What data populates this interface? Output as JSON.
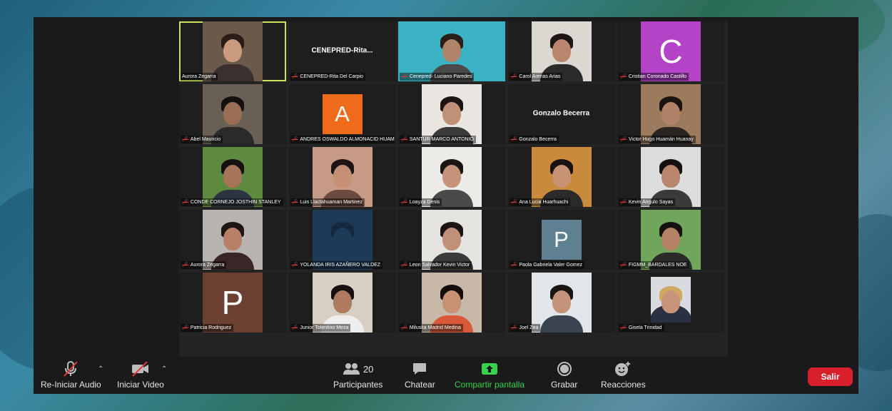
{
  "participants": [
    {
      "name": "Aurora Zegarra",
      "type": "video",
      "active": true,
      "bg": "#6b5a4a",
      "skin": "#c99a7e",
      "hair": "#2a1d17",
      "shirt": "#3a3030"
    },
    {
      "name": "CENEPRED-Rita Del Carpio",
      "type": "name",
      "display": "CENEPRED-Rita..."
    },
    {
      "name": "Cenepred- Luciano Paredes",
      "type": "video",
      "wide": true,
      "bg": "#3bb3c4",
      "skin": "#b08468",
      "hair": "#2a1f18",
      "shirt": "#4a4a4a"
    },
    {
      "name": "Carol Arenas Arias",
      "type": "video",
      "bg": "#ddd7d2",
      "skin": "#b8866c",
      "hair": "#1e1614",
      "shirt": "#2b2b2b"
    },
    {
      "name": "Cristian Coronado Castillo",
      "type": "letter",
      "letter": "C",
      "color": "#b443c8"
    },
    {
      "name": "Abel Mauricio",
      "type": "video",
      "bg": "#6a5f55",
      "skin": "#9a6e55",
      "hair": "#141010",
      "shirt": "#2a2a2a"
    },
    {
      "name": "ANDRES OSWALDO ALMONACID HUAMAN",
      "type": "letter",
      "letter": "A",
      "color": "#ef6a1a"
    },
    {
      "name": "SANTUR MARCO ANTONIO",
      "type": "video",
      "bg": "#e9e6e2",
      "skin": "#c09078",
      "hair": "#1b1412",
      "shirt": "#3a3a3a"
    },
    {
      "name": "Gonzalo Becerra",
      "type": "name",
      "display": "Gonzalo Becerra"
    },
    {
      "name": "Victor Hugo Huamán Huanay",
      "type": "video",
      "bg": "#9c7a5c",
      "skin": "#b28268",
      "hair": "#1a1311",
      "shirt": "#2a2520"
    },
    {
      "name": "CONDE CORNEJO JOSTHIN STANLEY",
      "type": "video",
      "bg": "#5d8a3f",
      "skin": "#a57459",
      "hair": "#161010",
      "shirt": "#2c3440"
    },
    {
      "name": "Luis Llactahuaman Martinez",
      "type": "video",
      "bg": "#c79a85",
      "skin": "#c58f73",
      "hair": "#1d1513",
      "shirt": "#6b4a40"
    },
    {
      "name": "Loayza Denis",
      "type": "video",
      "bg": "#ecebe7",
      "skin": "#c4937a",
      "hair": "#1a1412",
      "shirt": "#4a4a4a"
    },
    {
      "name": "Ana Lucia Huarhuachi",
      "type": "video",
      "bg": "#c98a3c",
      "skin": "#c89274",
      "hair": "#1a1210",
      "shirt": "#2a2a2a"
    },
    {
      "name": "Kevin Angulo Sayas",
      "type": "video",
      "bg": "#dcdcdc",
      "skin": "#b8866d",
      "hair": "#161010",
      "shirt": "#3a3a3a"
    },
    {
      "name": "Aurora Zegarra",
      "type": "video",
      "bg": "#b8b4b0",
      "skin": "#b88066",
      "hair": "#1e1412",
      "shirt": "#3a2626"
    },
    {
      "name": "YOLANDA IRIS AZAÑERO VALDEZ",
      "type": "video",
      "bg": "#1d3a56",
      "skin": "#1d3a56",
      "hair": "#14293e",
      "shirt": "#1d3a56"
    },
    {
      "name": "Leon Salvador Kevin Victor",
      "type": "video",
      "bg": "#e6e4e0",
      "skin": "#c09078",
      "hair": "#1a1412",
      "shirt": "#3a3a3a"
    },
    {
      "name": "Paola Gabriela Valer Gomez",
      "type": "letter",
      "letter": "P",
      "color": "#5f8090"
    },
    {
      "name": "FIGMM_BARDALES NOE",
      "type": "video",
      "bg": "#6fa65c",
      "skin": "#b78367",
      "hair": "#161010",
      "shirt": "#2a2a2a"
    },
    {
      "name": "Patricia Rodriguez",
      "type": "letter",
      "letter": "P",
      "color": "#6b4030"
    },
    {
      "name": "Junior Tolentino Meza",
      "type": "video",
      "bg": "#d8cfc4",
      "skin": "#b07a60",
      "hair": "#161010",
      "shirt": "#eeeeee"
    },
    {
      "name": "Miluska Madrid Medina",
      "type": "video",
      "bg": "#c8b8a8",
      "skin": "#c79174",
      "hair": "#120c0b",
      "shirt": "#d85a3a"
    },
    {
      "name": "Joel Zea",
      "type": "video",
      "bg": "#e2e6ea",
      "skin": "#c4937a",
      "hair": "#1a1412",
      "shirt": "#3a4450"
    },
    {
      "name": "Gisela Trinidad",
      "type": "video",
      "small": true,
      "bg": "#d8dce0",
      "skin": "#c9957a",
      "hair": "#d0a860",
      "shirt": "#2a3040"
    }
  ],
  "toolbar": {
    "audio_label": "Re-Iniciar Audio",
    "video_label": "Iniciar Video",
    "participants_label": "Participantes",
    "participants_count": "20",
    "chat_label": "Chatear",
    "share_label": "Compartir pantalla",
    "record_label": "Grabar",
    "reactions_label": "Reacciones",
    "leave_label": "Salir",
    "share_color": "#38d34c",
    "leave_color": "#d8202c"
  }
}
